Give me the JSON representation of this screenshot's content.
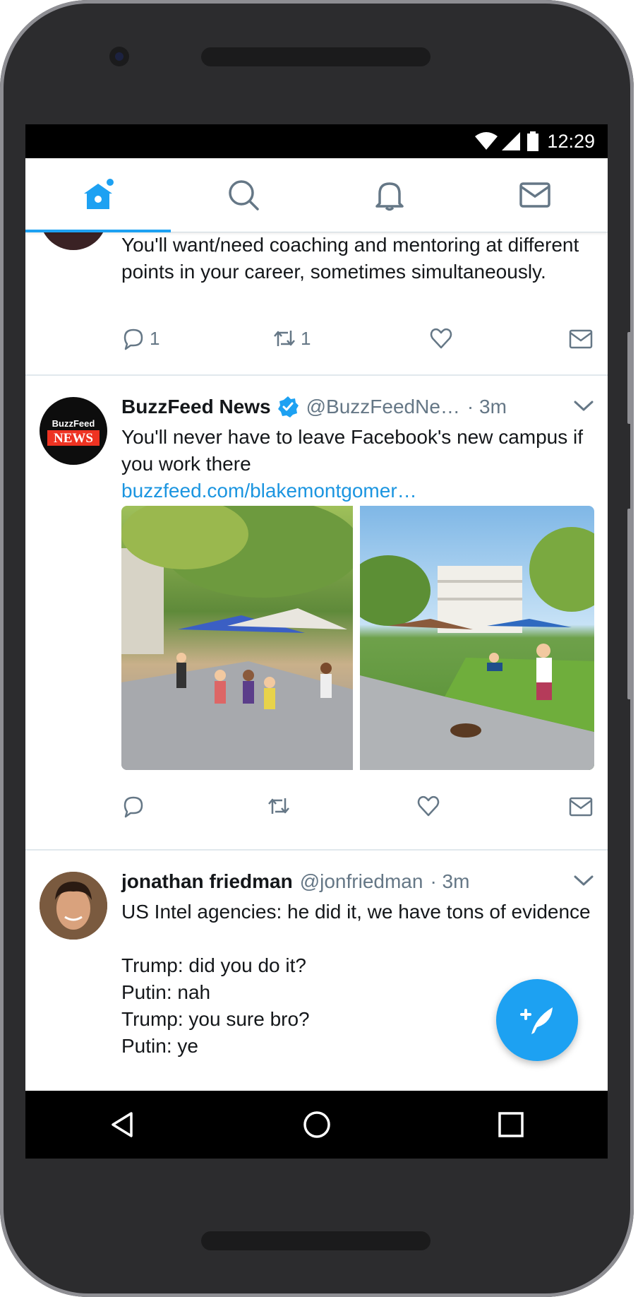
{
  "status_bar": {
    "time": "12:29"
  },
  "tabs": [
    {
      "name": "home",
      "active": true
    },
    {
      "name": "search",
      "active": false
    },
    {
      "name": "notifications",
      "active": false
    },
    {
      "name": "messages",
      "active": false
    }
  ],
  "tweets": [
    {
      "text": "You'll want/need coaching and mentoring at different points in your career, sometimes simultaneously.",
      "replies": "1",
      "retweets": "1"
    },
    {
      "display_name": "BuzzFeed News",
      "avatar_text_top": "BuzzFeed",
      "avatar_text_bottom": "NEWS",
      "handle": "@BuzzFeedNe…",
      "time": "· 3m",
      "text": "You'll never have to leave Facebook's new campus if you work there",
      "link": "buzzfeed.com/blakemontgomer…"
    },
    {
      "display_name": "jonathan friedman",
      "handle": "@jonfriedman",
      "time": "· 3m",
      "text": "US Intel agencies: he did it, we have tons of evidence\n\nTrump: did you do it?\nPutin: nah\nTrump: you sure bro?\nPutin: ye"
    }
  ],
  "colors": {
    "accent": "#1da1f2",
    "link": "#1b95e0",
    "text": "#14171a",
    "secondary": "#657786"
  }
}
